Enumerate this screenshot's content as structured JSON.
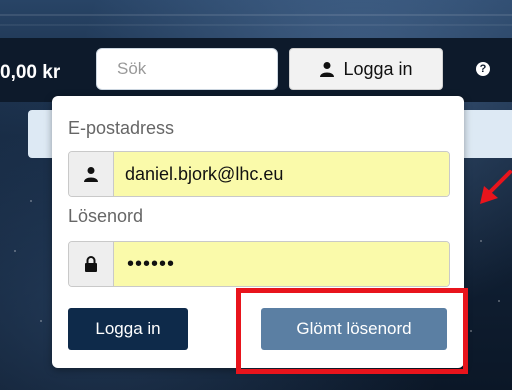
{
  "header": {
    "cart_total": "0,00 kr",
    "search_placeholder": "Sök",
    "login_label": "Logga in",
    "help_icon": "?"
  },
  "login_dropdown": {
    "email_label": "E-postadress",
    "email_value": "daniel.bjork@lhc.eu",
    "password_label": "Lösenord",
    "password_value": "••••••",
    "login_button": "Logga in",
    "forgot_button": "Glömt lösenord"
  },
  "colors": {
    "highlight": "#e8141c",
    "login_button": "#0e2a4a",
    "forgot_button": "#5b7fa3",
    "autofill": "#fafaaa"
  },
  "icons": [
    "user-icon",
    "lock-icon",
    "help-icon",
    "arrow-icon"
  ]
}
